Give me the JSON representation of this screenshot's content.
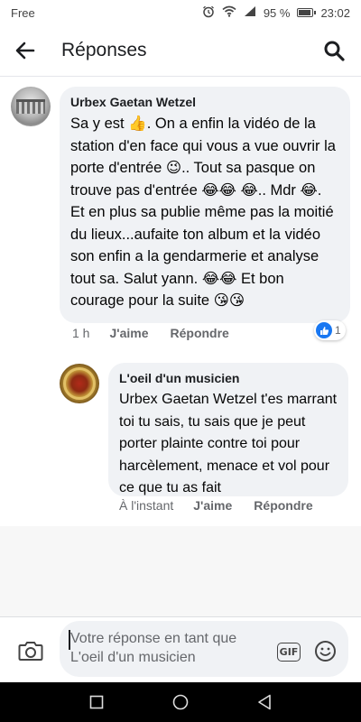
{
  "status_bar": {
    "carrier": "Free",
    "battery_percent": "95 %",
    "time": "23:02",
    "icons": [
      "alarm-icon",
      "wifi-icon",
      "signal-icon",
      "battery-icon"
    ]
  },
  "header": {
    "title": "Réponses",
    "back_icon": "arrow-left-icon",
    "search_icon": "search-icon"
  },
  "comments": [
    {
      "author": "Urbex Gaetan Wetzel",
      "text": "Sa y est 👍. On a enfin la vidéo de la station d'en face qui vous a vue ouvrir la porte d'entrée 😉.. Tout sa pasque on trouve pas d'entrée 😂😂 😂.. Mdr 😂. Et en plus sa publie même pas la moitié du lieux...aufaite ton album et la vidéo son enfin a la gendarmerie et analyse tout sa. Salut yann. 😂😂 Et bon courage pour la suite 😘😘",
      "time": "1 h",
      "like_label": "J'aime",
      "reply_label": "Répondre",
      "reaction_count": "1"
    },
    {
      "author": "L'oeil d'un musicien",
      "text": "Urbex Gaetan Wetzel t'es marrant toi tu sais, tu sais que je peut porter plainte contre toi pour harcèlement, menace et vol pour ce que tu as fait",
      "time": "À l'instant",
      "like_label": "J'aime",
      "reply_label": "Répondre"
    }
  ],
  "composer": {
    "placeholder": "Votre réponse en tant que L'oeil d'un musicien",
    "gif_label": "GIF",
    "icons": [
      "camera-icon",
      "gif-icon",
      "emoji-icon"
    ]
  },
  "nav_bar": {
    "icons": [
      "recent-apps-icon",
      "home-icon",
      "back-triangle-icon"
    ]
  },
  "colors": {
    "bubble": "#f0f2f5",
    "muted_text": "#65676b",
    "like_blue": "#1877f2"
  }
}
